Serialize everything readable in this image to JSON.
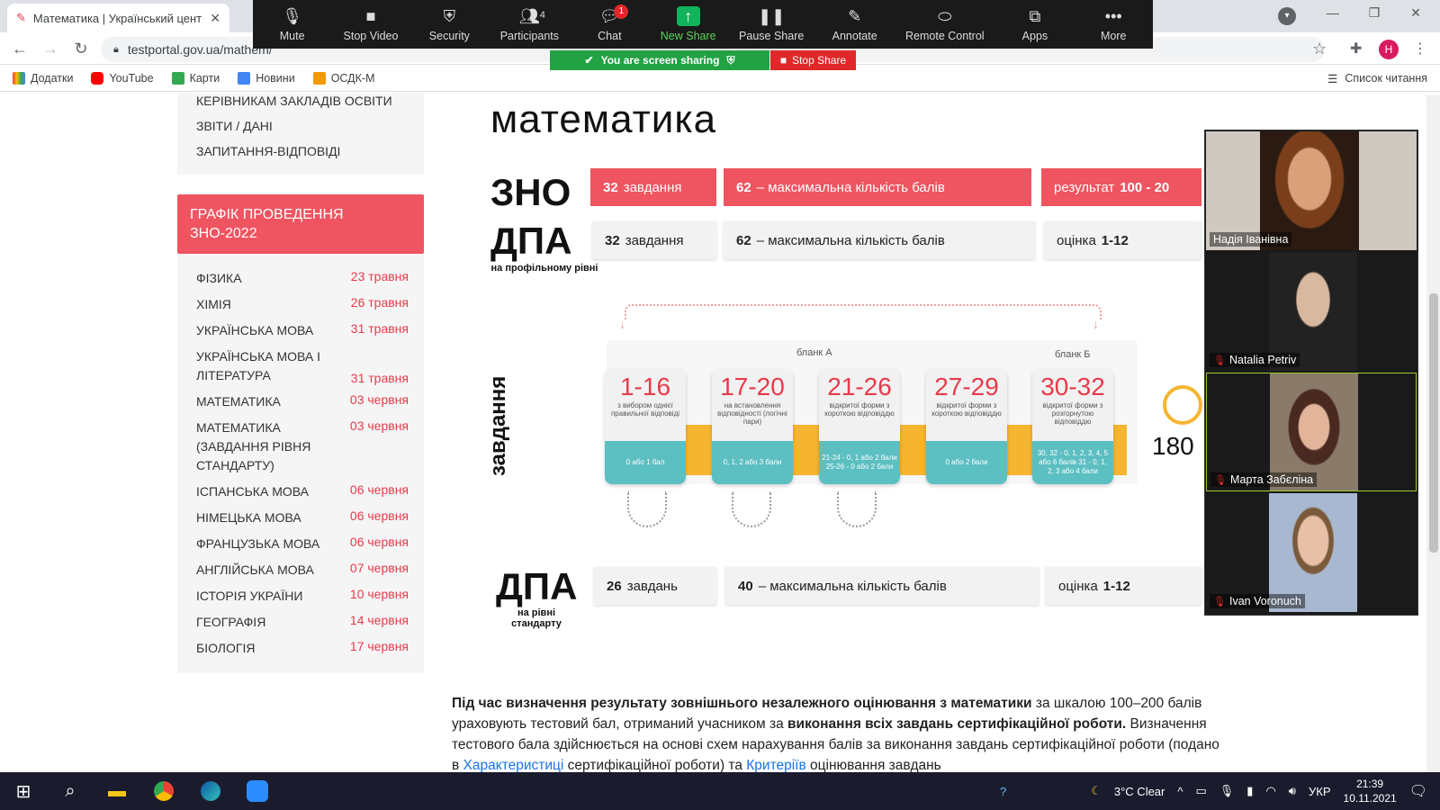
{
  "browser": {
    "tab_title": "Математика | Український цент",
    "url": "testportal.gov.ua/mathem/",
    "bookmarks": [
      "Додатки",
      "YouTube",
      "Карти",
      "Новини",
      "ОСДК-М"
    ],
    "reading_list": "Список читання",
    "profile_initial": "Н"
  },
  "zoom": {
    "buttons": [
      "Mute",
      "Stop Video",
      "Security",
      "Participants",
      "Chat",
      "New Share",
      "Pause Share",
      "Annotate",
      "Remote Control",
      "Apps",
      "More"
    ],
    "participants_count": "4",
    "chat_badge": "1",
    "sharing_text": "You are screen sharing",
    "stop_share": "Stop Share",
    "participants": [
      "Надія Іванівна",
      "Natalia Petriv",
      "Марта Забєліна",
      "Ivan Voronuch"
    ]
  },
  "sidebar": {
    "menu": [
      "КЕРІВНИКАМ ЗАКЛАДІВ ОСВІТИ",
      "ЗВІТИ / ДАНІ",
      "ЗАПИТАННЯ-ВІДПОВІДІ"
    ],
    "schedule_title": "ГРАФІК ПРОВЕДЕННЯ ЗНО-2022",
    "schedule": [
      {
        "subject": "ФІЗИКА",
        "date": "23 травня"
      },
      {
        "subject": "ХІМІЯ",
        "date": "26 травня"
      },
      {
        "subject": "УКРАЇНСЬКА МОВА",
        "date": "31 травня"
      },
      {
        "subject": "УКРАЇНСЬКА МОВА І ЛІТЕРАТУРА",
        "date": "31 травня"
      },
      {
        "subject": "МАТЕМАТИКА",
        "date": "03 червня"
      },
      {
        "subject": "МАТЕМАТИКА (ЗАВДАННЯ РІВНЯ СТАНДАРТУ)",
        "date": "03 червня"
      },
      {
        "subject": "ІСПАНСЬКА МОВА",
        "date": "06 червня"
      },
      {
        "subject": "НІМЕЦЬКА МОВА",
        "date": "06 червня"
      },
      {
        "subject": "ФРАНЦУЗЬКА МОВА",
        "date": "06 червня"
      },
      {
        "subject": "АНГЛІЙСЬКА МОВА",
        "date": "07 червня"
      },
      {
        "subject": "ІСТОРІЯ УКРАЇНИ",
        "date": "10 червня"
      },
      {
        "subject": "ГЕОГРАФІЯ",
        "date": "14 червня"
      },
      {
        "subject": "БІОЛОГІЯ",
        "date": "17 червня"
      }
    ]
  },
  "info": {
    "title": "математика",
    "zno": "ЗНО",
    "dpa": "ДПА",
    "dpa_profile": "на профільному рівні",
    "dpa_std": "на рівні стандарту",
    "zno_tasks_n": "32",
    "zno_tasks": "завдання",
    "zno_max_n": "62",
    "zno_max": "– максимальна кількість балів",
    "zno_result": "результат",
    "zno_result_range": "100 - 20",
    "dpa_tasks_n": "32",
    "dpa_tasks": "завдання",
    "dpa_max_n": "62",
    "dpa_max": "– максимальна кількість балів",
    "dpa_grade": "оцінка",
    "dpa_grade_range": "1-12",
    "vertical": "завдання",
    "blank_a": "бланк А",
    "blank_b": "бланк Б",
    "cards": [
      {
        "range": "1-16",
        "desc": "з вибором однієї правильної відповіді",
        "score": "0 або 1 бал"
      },
      {
        "range": "17-20",
        "desc": "на встановлення відповідності (логічні пари)",
        "score": "0, 1, 2 або 3 бали"
      },
      {
        "range": "21-26",
        "desc": "відкритої форми з короткою відповіддю",
        "score": "21-24 - 0, 1 або 2 бали 25-26 - 0 або 2 бали"
      },
      {
        "range": "27-29",
        "desc": "відкритої форми з короткою відповіддю",
        "score": "0 або 2 бали"
      },
      {
        "range": "30-32",
        "desc": "відкритої форми з розгорнутою відповіддю",
        "score": "30, 32 - 0, 1, 2, 3, 4, 5 або 6 балів 31 - 0, 1, 2, 3 або 4 бали"
      }
    ],
    "timer": "180",
    "std_tasks_n": "26",
    "std_tasks": "завдань",
    "std_max_n": "40",
    "std_max": "– максимальна кількість балів",
    "std_grade": "оцінка",
    "std_grade_range": "1-12"
  },
  "article": {
    "b1": "Під час визначення результату зовнішнього незалежного оцінювання з математики",
    "t1": " за шкалою 100–200 балів ураховують тестовий бал, отриманий учасником за ",
    "b2": "виконання всіх завдань сертифікаційної роботи.",
    "t2": " Визначення тестового бала здійснюється на основі схем нарахування балів за виконання завдань сертифікаційної роботи (подано в ",
    "link1": "Характеристиці",
    "t3": " сертифікаційної роботи) та ",
    "link2": "Критеріїв",
    "t4": " оцінювання завдань"
  },
  "taskbar": {
    "weather": "3°C Clear",
    "lang": "УКР",
    "time": "21:39",
    "date": "10.11.2021"
  }
}
